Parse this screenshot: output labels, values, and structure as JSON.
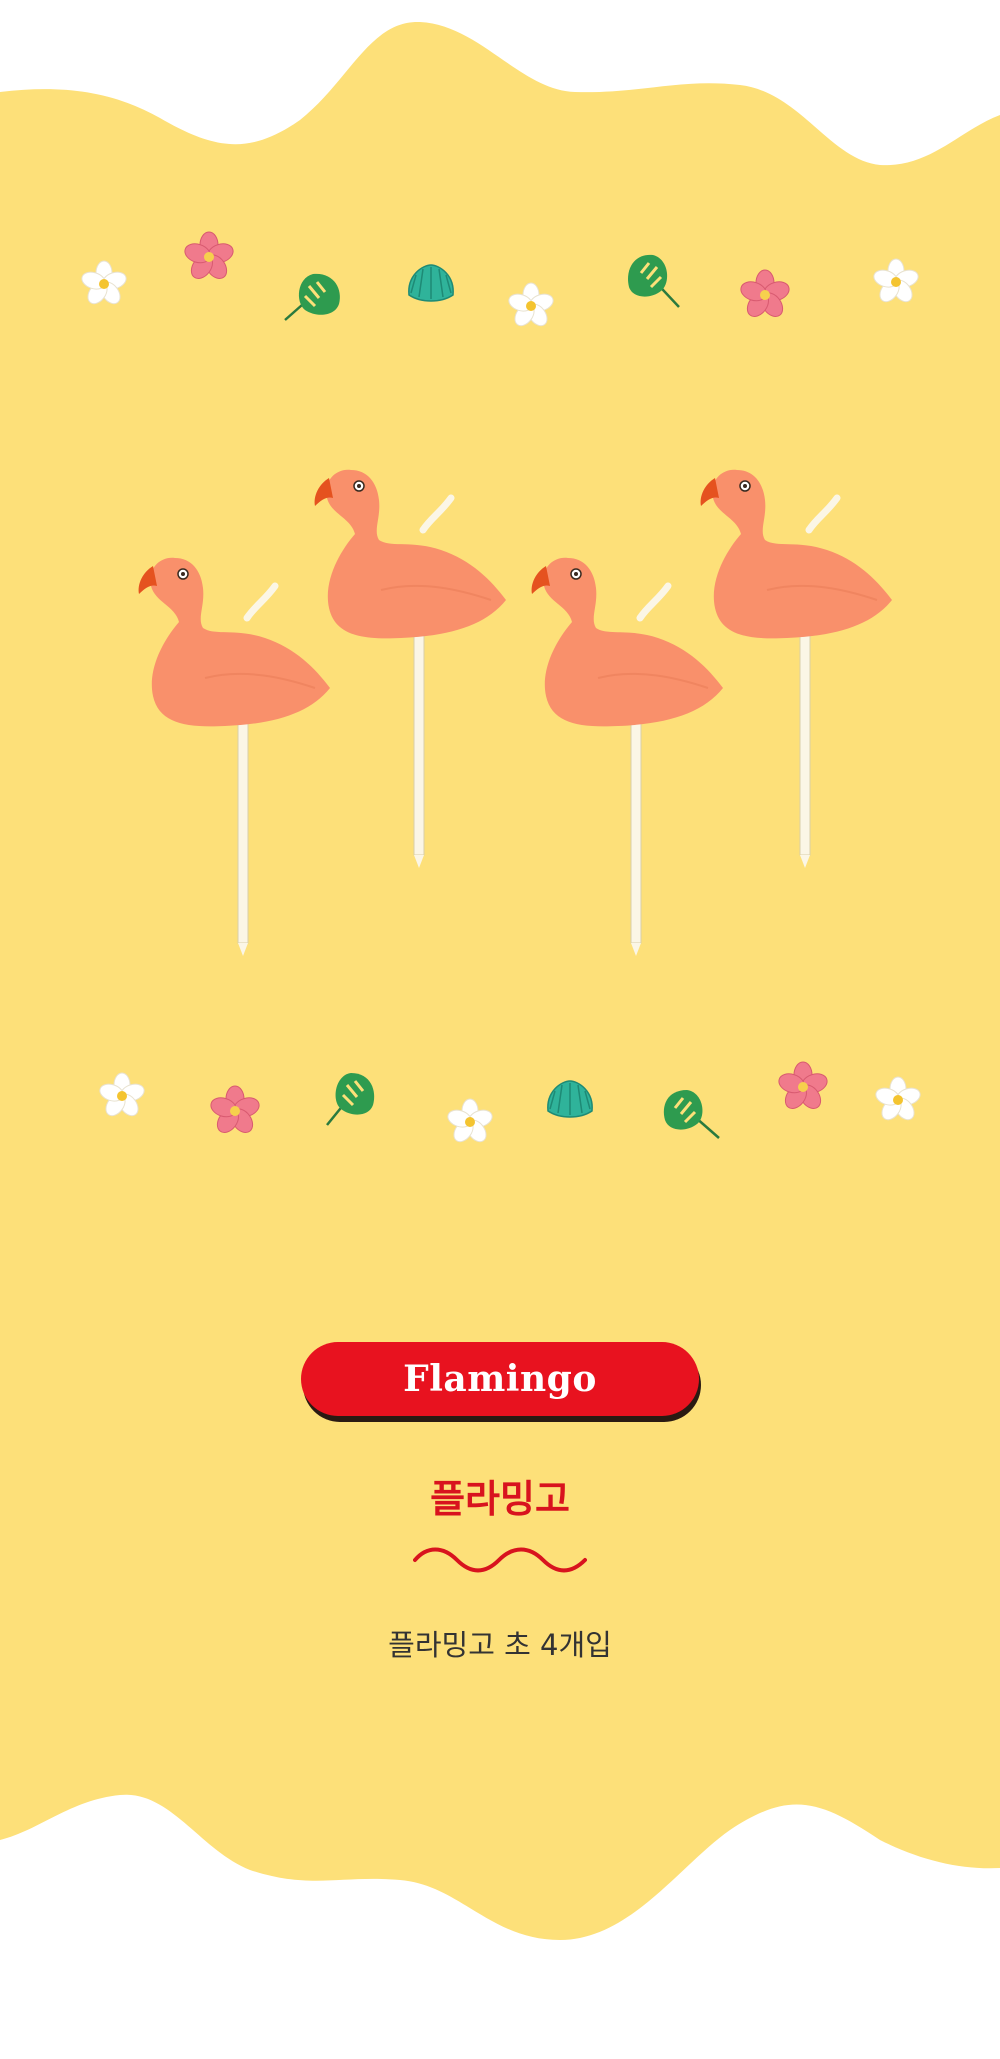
{
  "product": {
    "title_en": "Flamingo",
    "title_kr": "플라밍고",
    "description": "플라밍고 초 4개입"
  },
  "colors": {
    "background_yellow": "#fde079",
    "pill_red": "#e8121f",
    "title_red": "#d8131e",
    "flamingo_body": "#f9906b",
    "beak": "#e5521f",
    "stick": "#fbf6e6",
    "leaf_green": "#2e9b4f",
    "shell_teal": "#2fb39a",
    "flower_pink": "#f07a8c"
  },
  "icons": [
    "white-flower-icon",
    "pink-flower-icon",
    "monstera-leaf-icon",
    "seashell-icon",
    "flamingo-candle-icon",
    "wavy-line-icon"
  ],
  "decor": {
    "candle_count": 4
  }
}
